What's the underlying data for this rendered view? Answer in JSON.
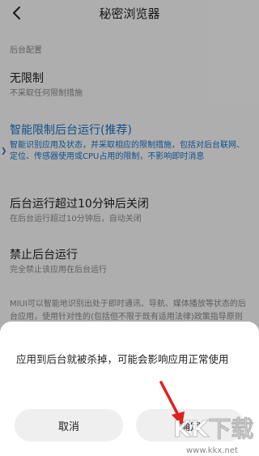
{
  "header": {
    "back_icon": "chevron-left-icon",
    "title": "秘密浏览器"
  },
  "section_label": "后台配置",
  "options": [
    {
      "title": "无限制",
      "desc": "不采取任何限制措施",
      "selected": false
    },
    {
      "title": "智能限制后台运行(推荐)",
      "desc": "智能识别应用及状态，并采取相应的限制措施，包括对后台联网、定位、传感器使用或CPU占用的限制，不影响即时消息",
      "selected": true
    },
    {
      "title": "后台运行超过10分钟后关闭",
      "desc": "在后台运行超过10分钟后，自动关闭",
      "selected": false
    },
    {
      "title": "禁止后台运行",
      "desc": "完全禁止该应用在后台运行",
      "selected": false
    }
  ],
  "footnote": "MIUI可以智能地识别出处于即时通讯、导航、媒体播放等状态的后台应用，使用针对性的(包括但不限于既有适用法律)政策指导原则限制其影响后台功能...",
  "dialog": {
    "message": "应用到后台就被杀掉，可能会影响应用正常使用",
    "cancel_label": "取消",
    "ok_label": "确定"
  },
  "watermark": {
    "text": "KK下载",
    "url_text": "www.kkx.net"
  },
  "colors": {
    "accent": "#1a73c6",
    "arrow": "#e0201e"
  }
}
